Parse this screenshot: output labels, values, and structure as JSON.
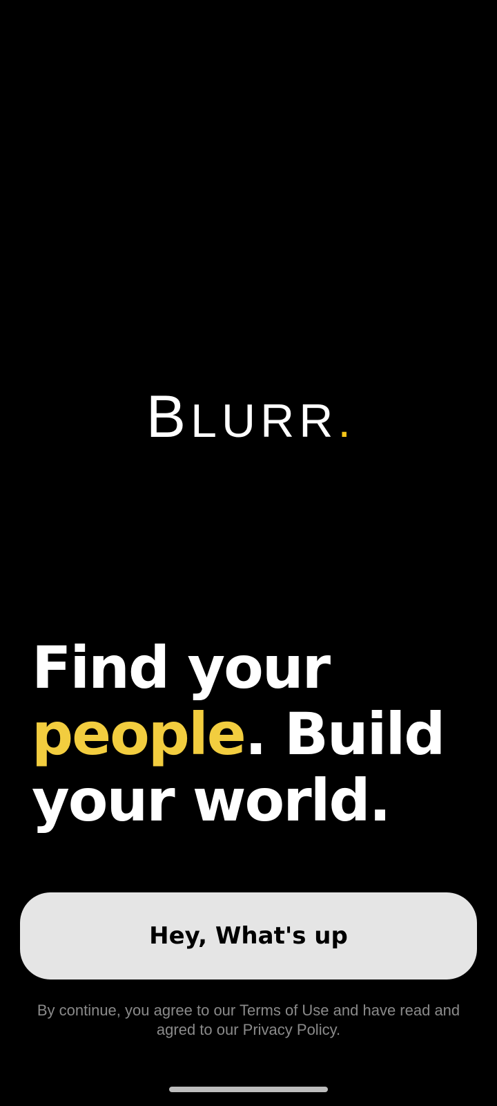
{
  "logo": {
    "initial": "B",
    "rest": "LURR",
    "dot": ".",
    "accent_color": "#f5c518"
  },
  "headline": {
    "line1": "Find your",
    "accent_word": "people",
    "line2_rest": ". Build",
    "line3": "your world.",
    "accent_color": "#f2cd3f"
  },
  "cta": {
    "label": "Hey, What's up"
  },
  "legal": {
    "prefix": "By continue, you agree to our ",
    "terms": "Terms of Use",
    "middle": " and have read and agred to our ",
    "privacy": "Privacy Policy",
    "suffix": "."
  },
  "system": {
    "home_indicator": "home-indicator"
  }
}
